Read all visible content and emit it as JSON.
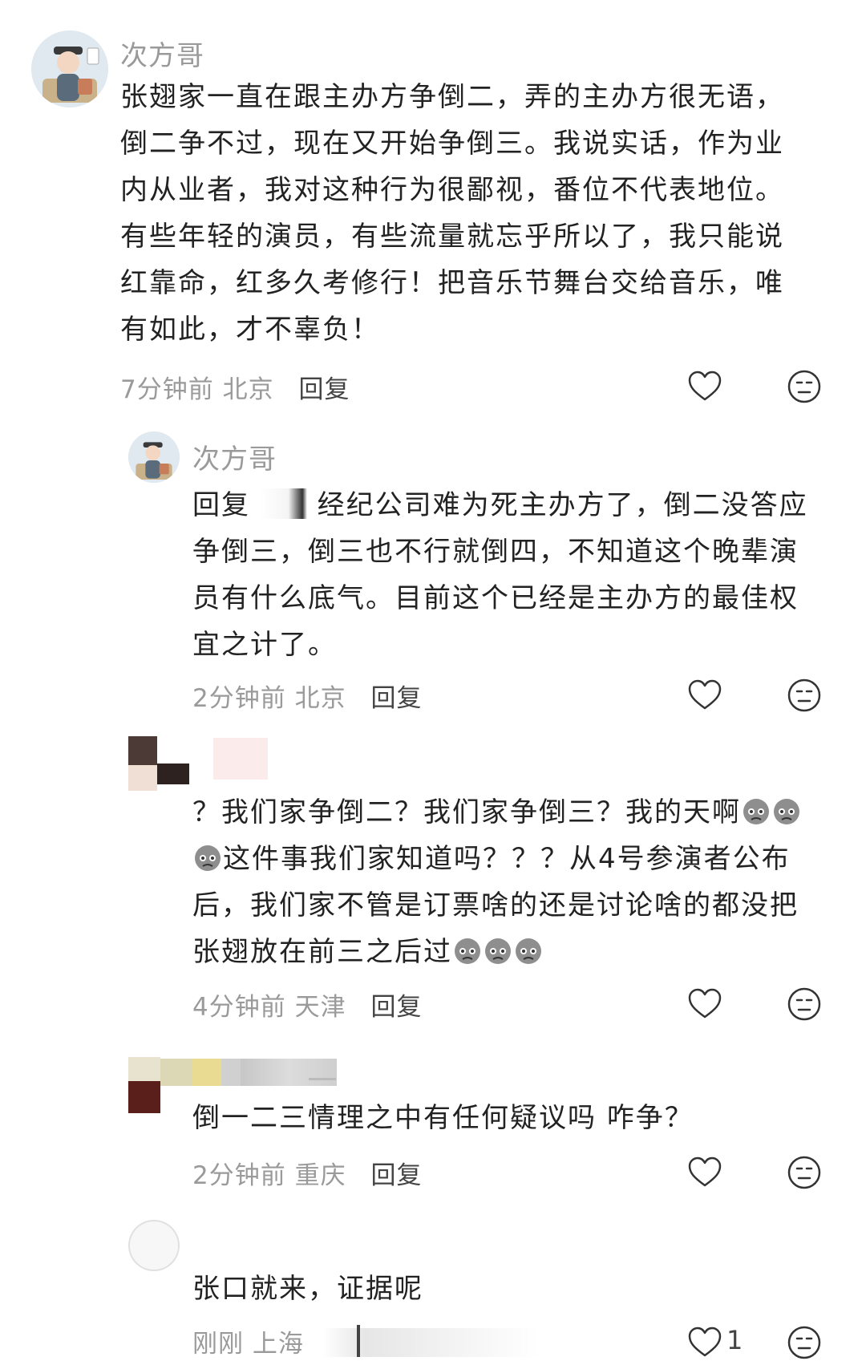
{
  "comments": [
    {
      "username": "次方哥",
      "text_lines": [
        "张翅家一直在跟主办方争倒二，弄的主办方很无语，",
        "倒二争不过，现在又开始争倒三。我说实话，作为业",
        "内从业者，我对这种行为很鄙视，番位不代表地位。",
        "有些年轻的演员，有些流量就忘乎所以了，我只能说",
        "红靠命，红多久考修行！把音乐节舞台交给音乐，唯",
        "有如此，才不辜负！"
      ],
      "time": "7分钟前",
      "location": "北京",
      "reply_label": "回复"
    },
    {
      "username": "次方哥",
      "reply_prefix": "回复",
      "text_first": "经纪公司难为死主办方了，倒二没答应",
      "text_lines": [
        "争倒三，倒三也不行就倒四，不知道这个晚辈演",
        "员有什么底气。目前这个已经是主办方的最佳权",
        "宜之计了。"
      ],
      "time": "2分钟前",
      "location": "北京",
      "reply_label": "回复"
    },
    {
      "line1": "？我们家争倒二？我们家争倒三？我的天啊",
      "line2": "这件事我们家知道吗？？？从4号参演者公布",
      "line3": "后，我们家不管是订票啥的还是讨论啥的都没把",
      "line4": "张翅放在前三之后过",
      "time": "4分钟前",
      "location": "天津",
      "reply_label": "回复"
    },
    {
      "text": "倒一二三情理之中有任何疑议吗 咋争？",
      "time": "2分钟前",
      "location": "重庆",
      "reply_label": "回复"
    },
    {
      "text": "张口就来，证据呢",
      "time": "刚刚",
      "location": "上海",
      "like_count": "1"
    }
  ],
  "icons": {
    "like": "heart-outline-icon",
    "dislike": "unamused-face-icon",
    "emoji": "sad-pleading-emoji"
  }
}
